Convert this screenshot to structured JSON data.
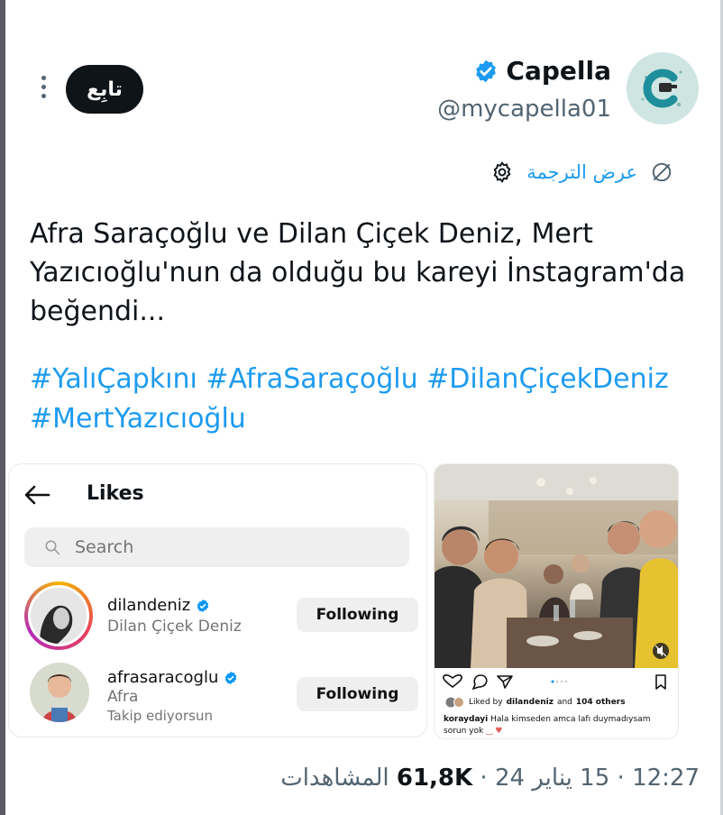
{
  "header": {
    "follow_label": "تابِع",
    "display_name": "Capella",
    "handle": "@mycapella01"
  },
  "translate": {
    "label": "عرض الترجمة"
  },
  "tweet": {
    "text": "Afra Saraçoğlu ve Dilan Çiçek Deniz, Mert Yazıcıoğlu'nun da olduğu bu kareyi İnstagram'da beğendi...",
    "hashtags": "#YalıÇapkını #AfraSaraçoğlu #DilanÇiçekDeniz #MertYazıcıoğlu"
  },
  "likes_screenshot": {
    "title": "Likes",
    "search_placeholder": "Search",
    "users": [
      {
        "username": "dilandeniz",
        "full_name": "Dilan Çiçek Deniz",
        "note": "",
        "button": "Following"
      },
      {
        "username": "afrasaracoglu",
        "full_name": "Afra",
        "note": "Takip ediyorsun",
        "button": "Following"
      }
    ]
  },
  "instagram_post": {
    "liked_by_prefix": "Liked by",
    "liked_by_user": "dilandeniz",
    "liked_by_and": "and",
    "liked_by_others": "104 others",
    "comment_user": "koraydayi",
    "comment_text": "Hala kimseden amca lafı duymadıysam sorun yok"
  },
  "meta": {
    "time": "12:27",
    "date": "15 يناير 24",
    "views_count": "61,8K",
    "views_label": "المشاهدات"
  },
  "colors": {
    "accent": "#1d9bf0",
    "verified": "#1d9bf0",
    "text": "#0f1419",
    "muted": "#536471"
  }
}
